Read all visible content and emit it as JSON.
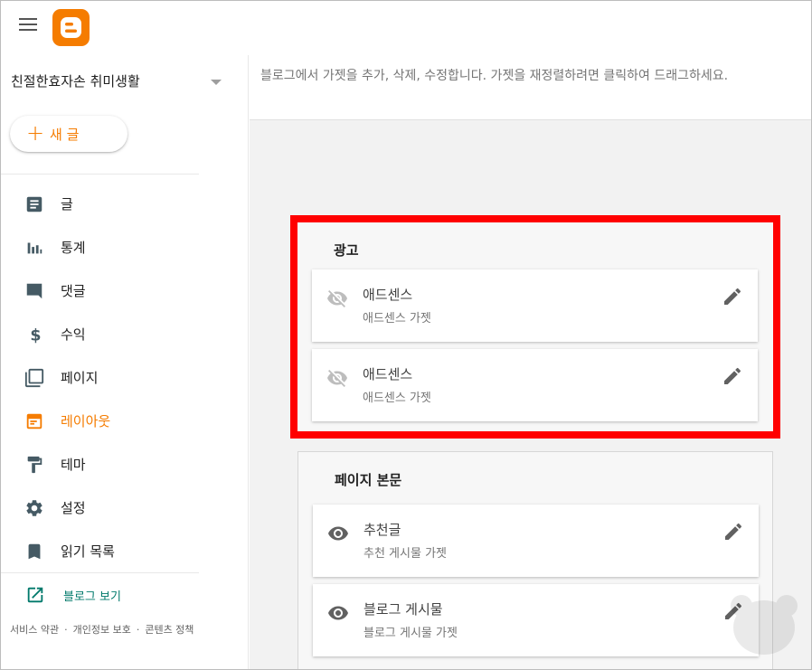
{
  "sidebar": {
    "blog_name": "친절한효자손 취미생활",
    "new_post_label": "새 글",
    "nav": [
      {
        "label": "글",
        "icon": "posts-icon",
        "active": false
      },
      {
        "label": "통계",
        "icon": "stats-icon",
        "active": false
      },
      {
        "label": "댓글",
        "icon": "comments-icon",
        "active": false
      },
      {
        "label": "수익",
        "icon": "earnings-icon",
        "active": false
      },
      {
        "label": "페이지",
        "icon": "pages-icon",
        "active": false
      },
      {
        "label": "레이아웃",
        "icon": "layout-icon",
        "active": true
      },
      {
        "label": "테마",
        "icon": "theme-icon",
        "active": false
      },
      {
        "label": "설정",
        "icon": "settings-icon",
        "active": false
      },
      {
        "label": "읽기 목록",
        "icon": "reading-list-icon",
        "active": false
      }
    ],
    "view_blog_label": "블로그 보기",
    "footer": {
      "terms": "서비스 약관",
      "privacy": "개인정보 보호",
      "content_policy": "콘텐츠 정책"
    }
  },
  "main": {
    "description": "블로그에서 가젯을 추가, 삭제, 수정합니다. 가젯을 재정렬하려면 클릭하여 드래그하세요.",
    "sections": [
      {
        "title": "광고",
        "highlighted": true,
        "gadgets": [
          {
            "name": "애드센스",
            "subtitle": "애드센스 가젯",
            "visible": false
          },
          {
            "name": "애드센스",
            "subtitle": "애드센스 가젯",
            "visible": false
          }
        ]
      },
      {
        "title": "페이지 본문",
        "highlighted": false,
        "gadgets": [
          {
            "name": "추천글",
            "subtitle": "추천 게시물 가젯",
            "visible": true
          },
          {
            "name": "블로그 게시물",
            "subtitle": "블로그 게시물 가젯",
            "visible": true
          }
        ]
      }
    ]
  },
  "colors": {
    "accent": "#f57c00",
    "link": "#00796b",
    "highlight": "#ff0000"
  }
}
